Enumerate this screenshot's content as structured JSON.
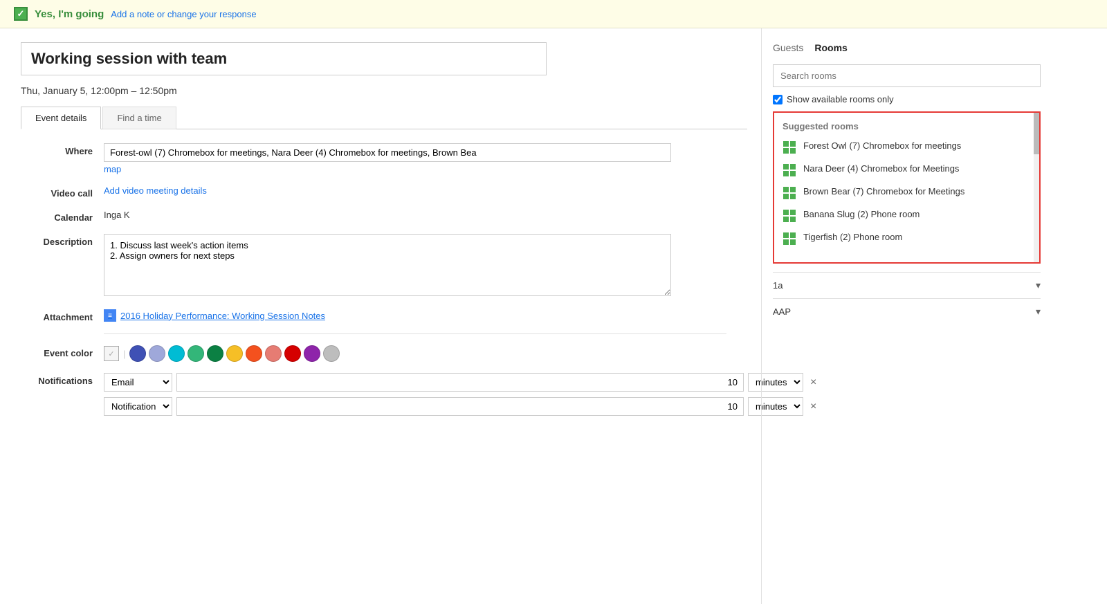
{
  "banner": {
    "going_label": "Yes, I'm going",
    "note_link": "Add a note or change your response",
    "checkmark": "✓"
  },
  "event": {
    "title": "Working session with team",
    "datetime": "Thu, January 5, 12:00pm – 12:50pm",
    "where_value": "Forest-owl (7) Chromebox for meetings, Nara Deer (4) Chromebox for meetings, Brown Bea",
    "map_link": "map",
    "video_call_link": "Add video meeting details",
    "calendar_value": "Inga K",
    "description": "1. Discuss last week's action items\n2. Assign owners for next steps",
    "attachment_text": "2016 Holiday Performance: Working Session Notes"
  },
  "tabs": {
    "event_details": "Event details",
    "find_time": "Find a time"
  },
  "form_labels": {
    "where": "Where",
    "video_call": "Video call",
    "calendar": "Calendar",
    "description": "Description",
    "attachment": "Attachment",
    "event_color": "Event color",
    "notifications": "Notifications"
  },
  "colors": [
    {
      "name": "default",
      "hex": "#e8e8e8",
      "selected": true
    },
    {
      "name": "blueberry",
      "hex": "#3F51B5"
    },
    {
      "name": "lavender",
      "hex": "#9FA8DA"
    },
    {
      "name": "teal",
      "hex": "#00BCD4"
    },
    {
      "name": "sage",
      "hex": "#33B679"
    },
    {
      "name": "basil",
      "hex": "#0B8043"
    },
    {
      "name": "banana",
      "hex": "#F6BF26"
    },
    {
      "name": "tangerine",
      "hex": "#F4511E"
    },
    {
      "name": "flamingo",
      "hex": "#E67C73"
    },
    {
      "name": "tomato",
      "hex": "#D50000"
    },
    {
      "name": "grape",
      "hex": "#8E24AA"
    },
    {
      "name": "graphite",
      "hex": "#BDBDBD"
    }
  ],
  "notifications": [
    {
      "type": "Email",
      "value": "10",
      "unit": "minutes"
    },
    {
      "type": "Notification",
      "value": "10",
      "unit": "minutes"
    }
  ],
  "sidebar": {
    "guests_tab": "Guests",
    "rooms_tab": "Rooms",
    "search_placeholder": "Search rooms",
    "show_available_label": "Show available rooms only",
    "suggested_rooms_title": "Suggested rooms",
    "rooms": [
      {
        "name": "Forest Owl (7) Chromebox for meetings"
      },
      {
        "name": "Nara Deer (4) Chromebox for Meetings"
      },
      {
        "name": "Brown Bear (7) Chromebox for Meetings"
      },
      {
        "name": "Banana Slug (2) Phone room"
      },
      {
        "name": "Tigerfish (2) Phone room"
      }
    ],
    "section_1": "1a",
    "section_2": "AAP"
  }
}
